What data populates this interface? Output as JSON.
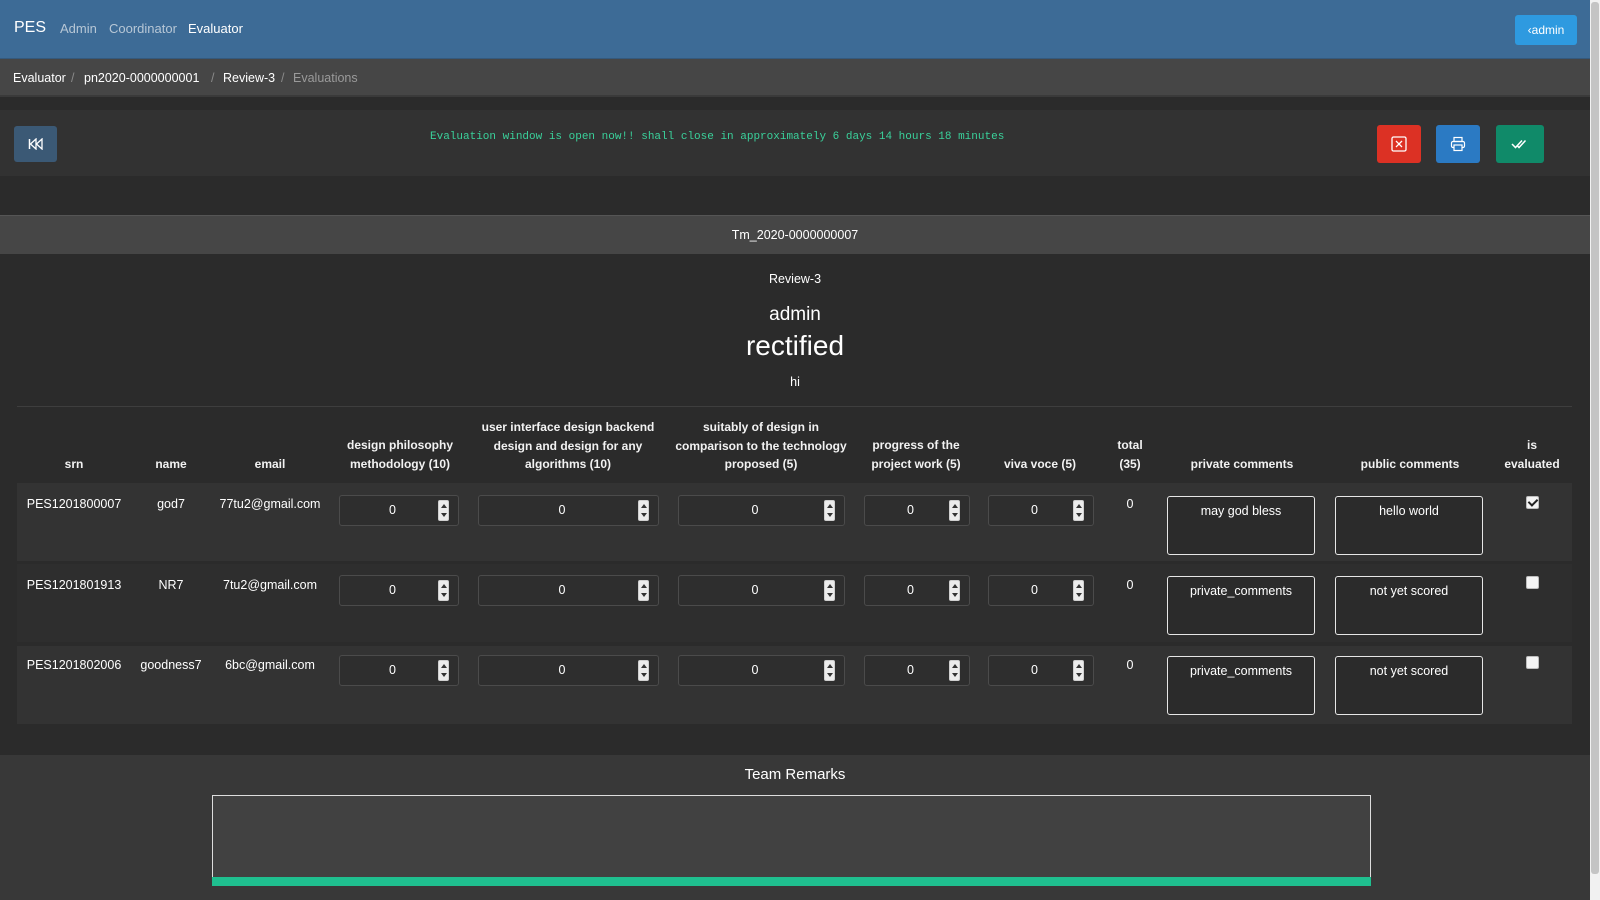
{
  "navbar": {
    "brand": "PES",
    "links": [
      "Admin",
      "Coordinator",
      "Evaluator"
    ],
    "user_button": "‹admin"
  },
  "breadcrumb": [
    "Evaluator",
    "pn2020-0000000001",
    "Review-3",
    "Evaluations"
  ],
  "toolbar": {
    "notice": "Evaluation window is open now!! shall close in approximately 6 days 14 hours 18 minutes",
    "colors": {
      "cancel": "#dc3124",
      "print": "#2b7ac3",
      "submit": "#108a69"
    }
  },
  "team": {
    "id": "Tm_2020-0000000007",
    "review": "Review-3",
    "evaluator": "admin",
    "status": "rectified",
    "note": "hi"
  },
  "table": {
    "headers": {
      "srn": "srn",
      "name": "name",
      "email": "email",
      "c1": [
        "design philosophy",
        "methodology (10)"
      ],
      "c2": [
        "user interface design backend",
        "design and design for any",
        "algorithms (10)"
      ],
      "c3": [
        "suitably of design in",
        "comparison to the technology",
        "proposed (5)"
      ],
      "c4": [
        "progress of the",
        "project work (5)"
      ],
      "c5": "viva voce (5)",
      "total": [
        "total",
        "(35)"
      ],
      "private": "private comments",
      "public": "public comments",
      "evaluated": [
        "is",
        "evaluated"
      ]
    },
    "rows": [
      {
        "srn": "PES1201800007",
        "name": "god7",
        "email": "77tu2@gmail.com",
        "c1": "0",
        "c2": "0",
        "c3": "0",
        "c4": "0",
        "c5": "0",
        "total": "0",
        "private": "may god bless",
        "public": "hello world",
        "evaluated": true
      },
      {
        "srn": "PES1201801913",
        "name": "NR7",
        "email": "7tu2@gmail.com",
        "c1": "0",
        "c2": "0",
        "c3": "0",
        "c4": "0",
        "c5": "0",
        "total": "0",
        "private": "private_comments",
        "public": "not yet scored",
        "evaluated": false
      },
      {
        "srn": "PES1201802006",
        "name": "goodness7",
        "email": "6bc@gmail.com",
        "c1": "0",
        "c2": "0",
        "c3": "0",
        "c4": "0",
        "c5": "0",
        "total": "0",
        "private": "private_comments",
        "public": "not yet scored",
        "evaluated": false
      }
    ]
  },
  "remarks": {
    "title": "Team Remarks",
    "value": ""
  }
}
